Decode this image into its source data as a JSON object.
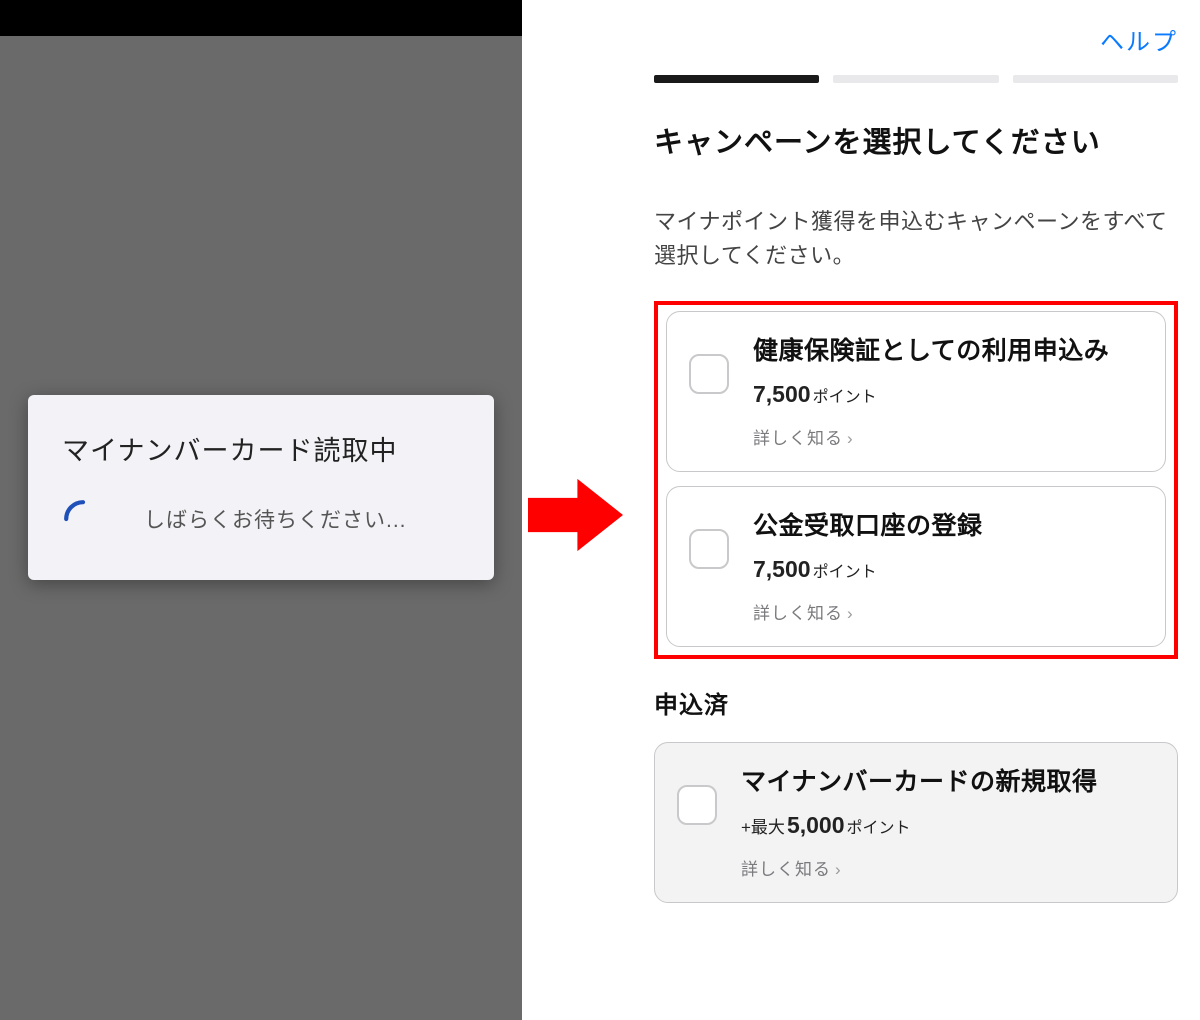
{
  "left": {
    "loading_title": "マイナンバーカード読取中",
    "loading_subtext": "しばらくお待ちください..."
  },
  "right": {
    "help_label": "ヘルプ",
    "page_title": "キャンペーンを選択してください",
    "page_desc": "マイナポイント獲得を申込むキャンペーンをすべて選択してください。",
    "options": [
      {
        "title": "健康保険証としての利用申込み",
        "points_value": "7,500",
        "points_unit": "ポイント",
        "more_label": "詳しく知る"
      },
      {
        "title": "公金受取口座の登録",
        "points_value": "7,500",
        "points_unit": "ポイント",
        "more_label": "詳しく知る"
      }
    ],
    "completed_label": "申込済",
    "completed_option": {
      "title": "マイナンバーカードの新規取得",
      "points_prefix": "+最大",
      "points_value": "5,000",
      "points_unit": "ポイント",
      "more_label": "詳しく知る"
    }
  }
}
